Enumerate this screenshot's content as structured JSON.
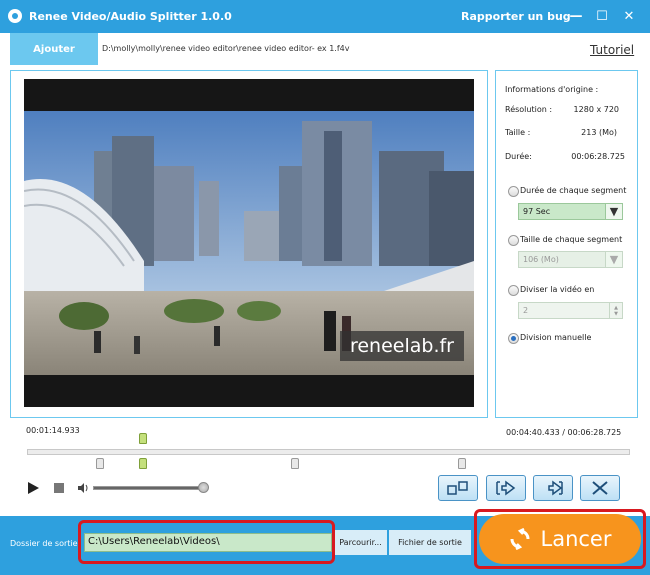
{
  "window": {
    "title": "Renee Video/Audio Splitter 1.0.0",
    "report_bug": "Rapporter un bug",
    "minimize": "—",
    "maximize": "☐",
    "close": "✕"
  },
  "toolbar": {
    "add_label": "Ajouter",
    "file_path": "D:\\molly\\molly\\renee video editor\\renee video editor- ex 1.f4v",
    "tutorial_label": "Tutoriel"
  },
  "preview": {
    "watermark": "reneelab.fr"
  },
  "info": {
    "header": "Informations d'origine :",
    "resolution_label": "Résolution :",
    "resolution_value": "1280 x 720",
    "size_label": "Taille :",
    "size_value": "213 (Mo)",
    "duration_label": "Durée:",
    "duration_value": "00:06:28.725"
  },
  "split_options": {
    "by_duration_label": "Durée de chaque segment",
    "duration_value": "97 Sec",
    "by_size_label": "Taille de chaque segment",
    "size_value": "106 (Mo)",
    "by_count_label": "Diviser la vidéo en",
    "count_value": "2",
    "manual_label": "Division manuelle",
    "selected": "manual"
  },
  "timeline": {
    "current_time": "00:01:14.933",
    "range_time": "00:04:40.433 / 00:06:28.725",
    "volume_level": 0.95
  },
  "output": {
    "label": "Dossier de sortie",
    "path": "C:\\Users\\Reneelab\\Videos\\",
    "browse_label": "Parcourir...",
    "output_file_label": "Fichier de sortie",
    "launch_label": "Lancer"
  },
  "colors": {
    "accent": "#2ea0de",
    "launch": "#f7941d",
    "highlight": "#d71920"
  }
}
